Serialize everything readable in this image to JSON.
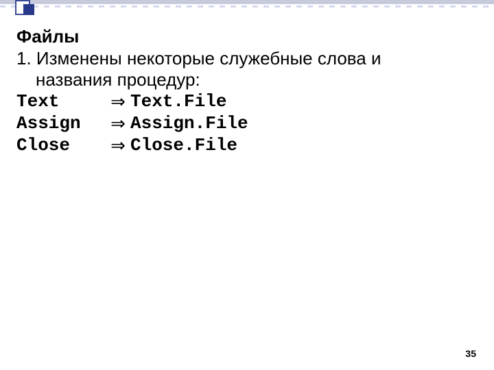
{
  "header": {
    "title": "Файлы"
  },
  "body": {
    "intro_line1": "1. Изменены некоторые служебные слова и",
    "intro_line2": "названия процедур:"
  },
  "mappings": [
    {
      "old": "Text",
      "arrow": "⇒",
      "new": "Text.File"
    },
    {
      "old": "Assign",
      "arrow": "⇒",
      "new": "Assign.File"
    },
    {
      "old": "Close",
      "arrow": "⇒",
      "new": "Close.File"
    }
  ],
  "footer": {
    "page": "35"
  }
}
